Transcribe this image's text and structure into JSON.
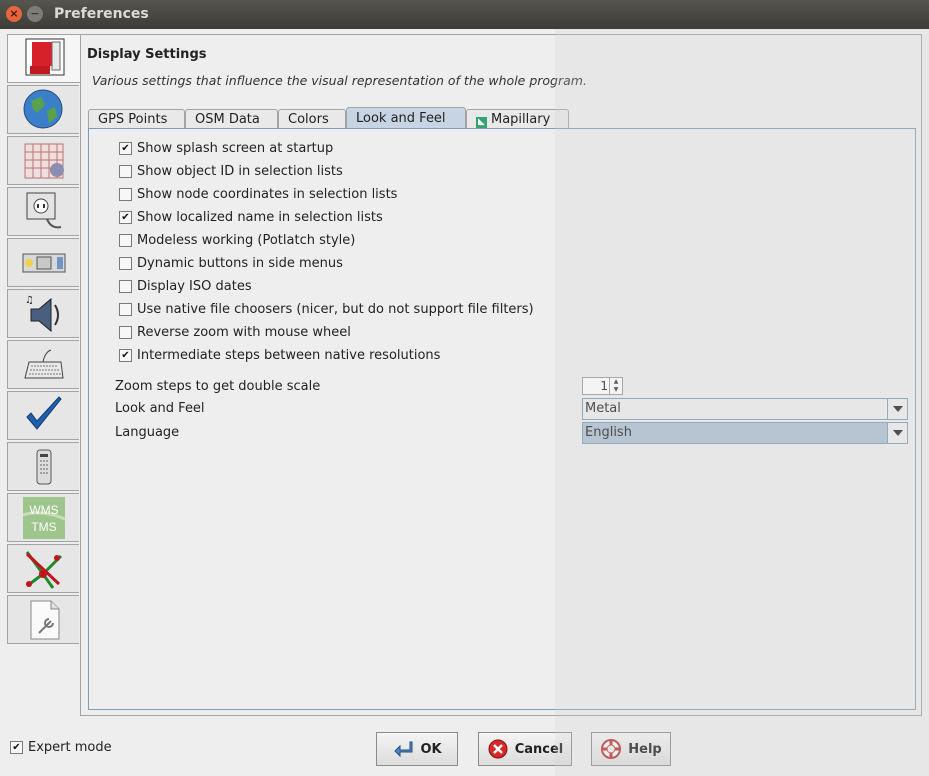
{
  "window": {
    "title": "Preferences",
    "close_glyph": "×",
    "minimize_glyph": "−"
  },
  "sidebar": {
    "items": [
      {
        "icon": "display-icon",
        "active": true
      },
      {
        "icon": "globe-icon"
      },
      {
        "icon": "projection-grid-icon"
      },
      {
        "icon": "plugin-icon"
      },
      {
        "icon": "toolbar-icon"
      },
      {
        "icon": "audio-icon"
      },
      {
        "icon": "keyboard-shortcut-icon"
      },
      {
        "icon": "validator-checkmark-icon"
      },
      {
        "icon": "remote-control-icon"
      },
      {
        "icon": "wms-tms-icon",
        "text": [
          "WMS",
          "TMS"
        ]
      },
      {
        "icon": "map-paint-icon"
      },
      {
        "icon": "advanced-settings-icon"
      }
    ]
  },
  "panel": {
    "title": "Display Settings",
    "description": "Various settings that influence the visual representation of the whole program."
  },
  "tabs": [
    {
      "label": "GPS Points",
      "selected": false
    },
    {
      "label": "OSM Data",
      "selected": false
    },
    {
      "label": "Colors",
      "selected": false
    },
    {
      "label": "Look and Feel",
      "selected": true
    },
    {
      "label": "Mapillary",
      "selected": false,
      "icon": "mapillary-icon"
    }
  ],
  "options": [
    {
      "label": "Show splash screen at startup",
      "checked": true
    },
    {
      "label": "Show object ID in selection lists",
      "checked": false
    },
    {
      "label": "Show node coordinates in selection lists",
      "checked": false
    },
    {
      "label": "Show localized name in selection lists",
      "checked": true
    },
    {
      "label": "Modeless working (Potlatch style)",
      "checked": false
    },
    {
      "label": "Dynamic buttons in side menus",
      "checked": false
    },
    {
      "label": "Display ISO dates",
      "checked": false
    },
    {
      "label": "Use native file choosers (nicer, but do not support file filters)",
      "checked": false
    },
    {
      "label": "Reverse zoom with mouse wheel",
      "checked": false
    },
    {
      "label": "Intermediate steps between native resolutions",
      "checked": true
    }
  ],
  "zoom_steps": {
    "label": "Zoom steps to get double scale",
    "value": "1"
  },
  "look_and_feel": {
    "label": "Look and Feel",
    "value": "Metal"
  },
  "language": {
    "label": "Language",
    "value": "English"
  },
  "expert_mode": {
    "label": "Expert mode",
    "checked": true
  },
  "buttons": {
    "ok": "OK",
    "cancel": "Cancel",
    "help": "Help"
  },
  "check_glyph": "✔"
}
